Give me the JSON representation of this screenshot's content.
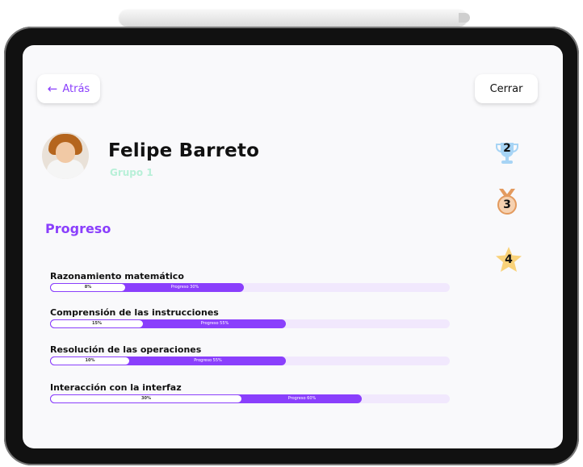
{
  "header": {
    "back_label": "Atrás",
    "close_label": "Cerrar"
  },
  "profile": {
    "name": "Felipe Barreto",
    "group": "Grupo 1"
  },
  "section": {
    "title": "Progreso"
  },
  "progress": [
    {
      "label": "Razonamiento matemático",
      "base_label": "8%",
      "base_value": 0.19,
      "fill_label": "Progreso 30%",
      "fill_value": 0.485
    },
    {
      "label": "Comprensión de las instrucciones",
      "base_label": "15%",
      "base_value": 0.235,
      "fill_label": "Progreso 55%",
      "fill_value": 0.59
    },
    {
      "label": "Resolución de las operaciones",
      "base_label": "10%",
      "base_value": 0.2,
      "fill_label": "Progreso 55%",
      "fill_value": 0.59
    },
    {
      "label": "Interacción con la interfaz",
      "base_label": "30%",
      "base_value": 0.48,
      "fill_label": "Progreso 60%",
      "fill_value": 0.78
    }
  ],
  "awards": [
    {
      "icon": "trophy-icon",
      "count": "2",
      "color": "#a7d4f5"
    },
    {
      "icon": "medal-icon",
      "count": "3",
      "color": "#e39a5e"
    },
    {
      "icon": "star-icon",
      "count": "4",
      "color": "#f9d27a"
    }
  ],
  "colors": {
    "accent": "#8a3ffc",
    "track": "#f1e8fd",
    "group": "#b8f0d8"
  }
}
